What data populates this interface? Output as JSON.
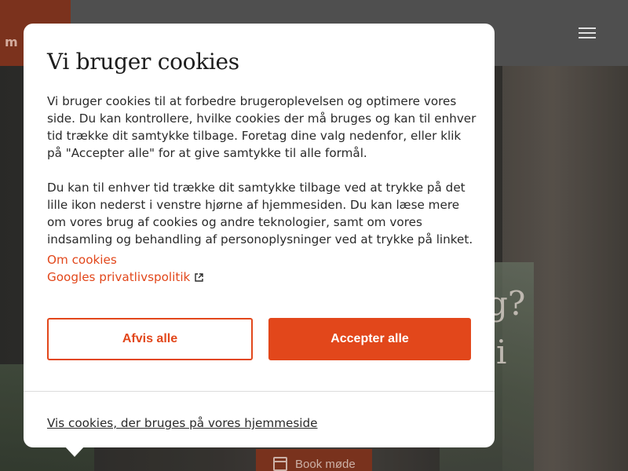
{
  "site": {
    "logo_text": "m",
    "hero_text_line1": "g?",
    "hero_text_line2": "i",
    "book_button_label": "Book møde"
  },
  "cookie_dialog": {
    "title": "Vi bruger cookies",
    "paragraph1": "Vi bruger cookies til at forbedre brugeroplevelsen og optimere vores side. Du kan kontrollere, hvilke cookies der må bruges og kan til enhver tid trække dit samtykke tilbage. Foretag dine valg nedenfor, eller klik på \"Accepter alle\" for at give samtykke til alle formål.",
    "paragraph2": "Du kan til enhver tid trække dit samtykke tilbage ved at trykke på det lille ikon nederst i venstre hjørne af hjemmesiden. Du kan læse mere om vores brug af cookies og andre teknologier, samt om vores indsamling og behandling af personoplysninger ved at trykke på linket.",
    "link_about_cookies": "Om cookies",
    "link_google_privacy": "Googles privatlivspolitik",
    "reject_all_label": "Afvis alle",
    "accept_all_label": "Accepter alle",
    "show_cookies_link": "Vis cookies, der bruges på vores hjemmeside"
  },
  "colors": {
    "accent": "#e2471b",
    "text": "#2a2a2a",
    "title": "#1d1d1d",
    "header_bg": "#5a5a5a",
    "logo_bg": "#8c3a22"
  },
  "icons": {
    "menu": "hamburger-menu-icon",
    "external_link": "external-link-icon",
    "calendar": "calendar-icon"
  }
}
